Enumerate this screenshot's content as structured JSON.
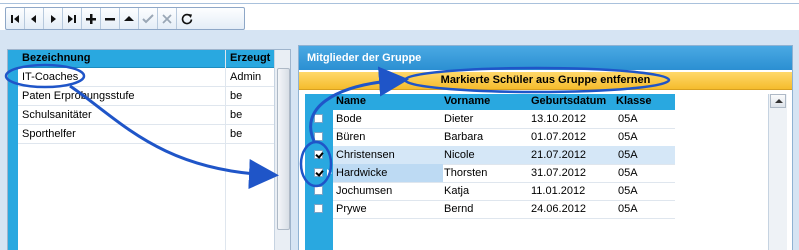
{
  "toolbar": {
    "buttons": [
      {
        "name": "first-record-button",
        "icon": "first-icon"
      },
      {
        "name": "prior-record-button",
        "icon": "prior-icon"
      },
      {
        "name": "next-record-button",
        "icon": "next-icon"
      },
      {
        "name": "last-record-button",
        "icon": "last-icon"
      },
      {
        "name": "insert-record-button",
        "icon": "plus-icon"
      },
      {
        "name": "delete-record-button",
        "icon": "minus-icon"
      },
      {
        "name": "edit-record-button",
        "icon": "up-triangle-icon"
      },
      {
        "name": "post-record-button",
        "icon": "check-icon"
      },
      {
        "name": "cancel-record-button",
        "icon": "cross-icon"
      },
      {
        "name": "refresh-button",
        "icon": "refresh-icon"
      }
    ]
  },
  "groups": {
    "columns": [
      "Bezeichnung",
      "Erzeugt"
    ],
    "rows": [
      {
        "bezeichnung": "IT-Coaches",
        "erzeugt": "Admin"
      },
      {
        "bezeichnung": "Paten Erprobungsstufe",
        "erzeugt": "be"
      },
      {
        "bezeichnung": "Schulsanitäter",
        "erzeugt": "be"
      },
      {
        "bezeichnung": "Sporthelfer",
        "erzeugt": "be"
      }
    ]
  },
  "members": {
    "title": "Mitglieder der Gruppe",
    "action_label": "Markierte Schüler aus Gruppe entfernen",
    "columns": [
      "Name",
      "Vorname",
      "Geburtsdatum",
      "Klasse"
    ],
    "rows": [
      {
        "name": "Bode",
        "vorname": "Dieter",
        "geburtsdatum": "13.10.2012",
        "klasse": "05A",
        "checked": false
      },
      {
        "name": "Büren",
        "vorname": "Barbara",
        "geburtsdatum": "01.07.2012",
        "klasse": "05A",
        "checked": false
      },
      {
        "name": "Christensen",
        "vorname": "Nicole",
        "geburtsdatum": "21.07.2012",
        "klasse": "05A",
        "checked": true
      },
      {
        "name": "Hardwicke",
        "vorname": "Thorsten",
        "geburtsdatum": "31.07.2012",
        "klasse": "05A",
        "checked": true
      },
      {
        "name": "Jochumsen",
        "vorname": "Katja",
        "geburtsdatum": "11.01.2012",
        "klasse": "05A",
        "checked": false
      },
      {
        "name": "Prywe",
        "vorname": "Bernd",
        "geburtsdatum": "24.06.2012",
        "klasse": "05A",
        "checked": false
      }
    ]
  },
  "colors": {
    "header_blue": "#29a8e0",
    "action_bar": "#f5bc2d",
    "annotation": "#1f55c8"
  }
}
